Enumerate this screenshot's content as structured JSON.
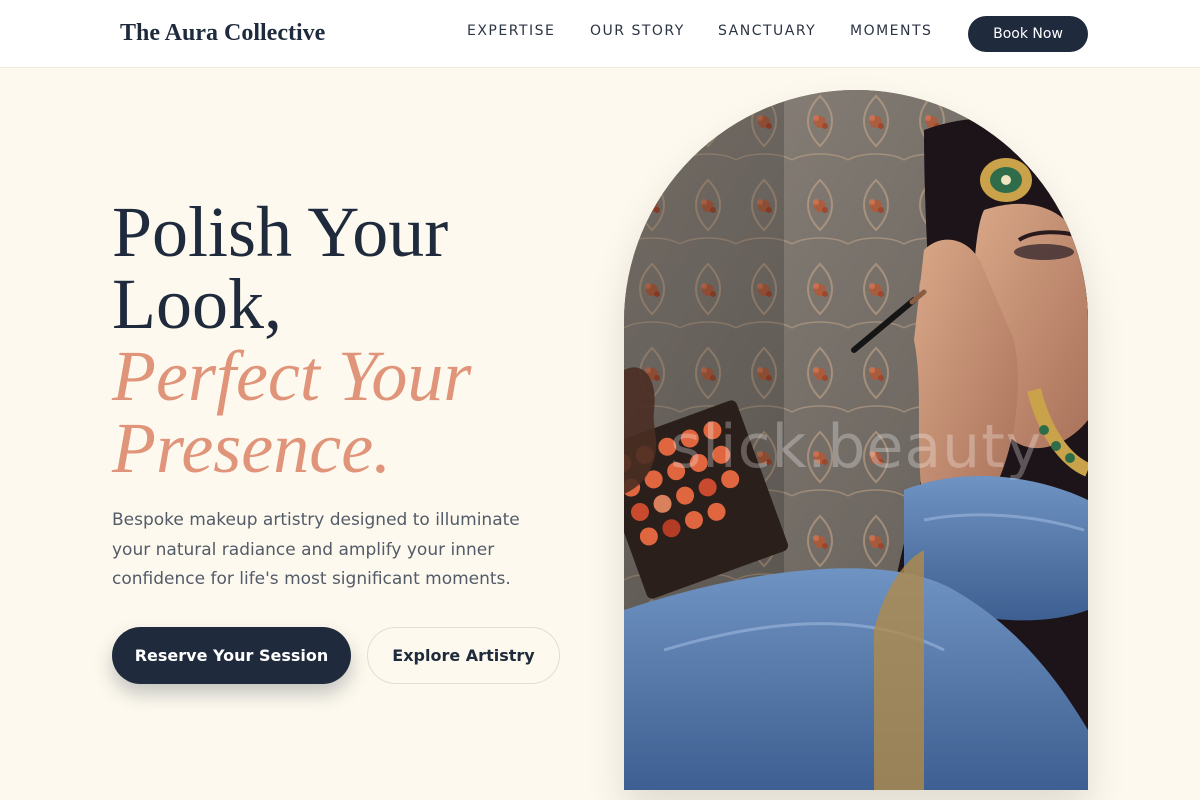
{
  "brand": {
    "name": "The Aura Collective"
  },
  "nav": {
    "links": [
      "EXPERTISE",
      "OUR STORY",
      "SANCTUARY",
      "MOMENTS"
    ],
    "cta_label": "Book Now"
  },
  "hero": {
    "headline_line1": "Polish Your",
    "headline_line2": "Look,",
    "accent_line1": "Perfect Your",
    "accent_line2": "Presence.",
    "description": "Bespoke makeup artistry designed to illuminate your natural radiance and amplify your inner confidence for life's most significant moments.",
    "primary_button": "Reserve Your Session",
    "secondary_button": "Explore Artistry",
    "image_watermark": "slick.beauty"
  },
  "colors": {
    "navy": "#1f2a3d",
    "accent": "#e0957a",
    "background": "#fdf9ee",
    "body_text": "#535b68"
  }
}
